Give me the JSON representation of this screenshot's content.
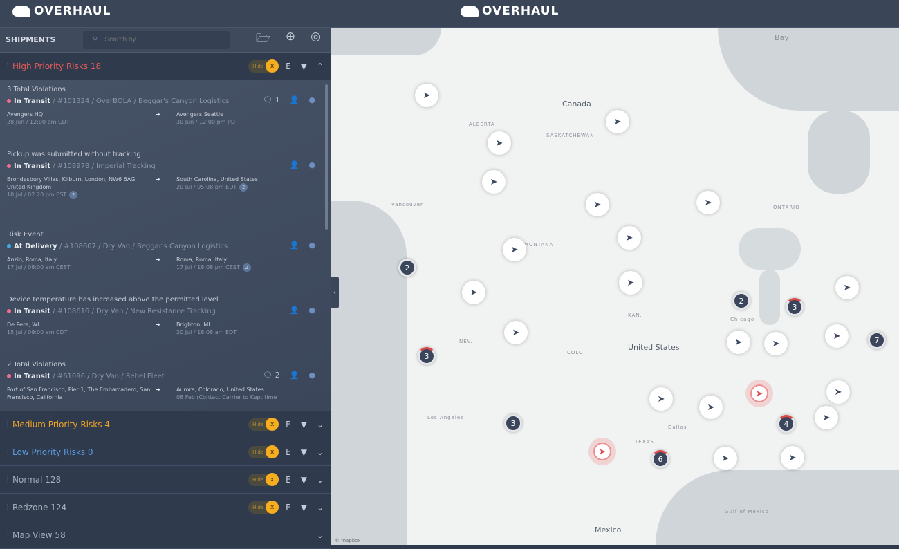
{
  "app": {
    "brand": "OVERHAUL"
  },
  "sidebar": {
    "title": "SHIPMENTS",
    "search_placeholder": "Search by",
    "groups": [
      {
        "name": "High Priority Risks 18",
        "color": "#e35a5a",
        "pill": "Hide",
        "badge": "x",
        "count": "E",
        "expanded": true
      },
      {
        "name": "Medium Priority Risks 4",
        "color": "#f0a526",
        "pill": "Hide",
        "badge": "x",
        "count": "E"
      },
      {
        "name": "Low Priority Risks 0",
        "color": "#5a9be0",
        "pill": "Hide",
        "badge": "x",
        "count": "E"
      },
      {
        "name": "Normal 128",
        "color": "#a5adba",
        "pill": "Hide",
        "badge": "x",
        "count": "E"
      },
      {
        "name": "Redzone 124",
        "color": "#a5adba",
        "pill": "Hide",
        "badge": "x",
        "count": "E"
      },
      {
        "name": "Map View 58",
        "color": "#a5adba"
      }
    ],
    "cards": [
      {
        "violation": "3 Total Violations",
        "status": "In Transit",
        "status_color": "#ef6d8f",
        "rest": " / #101324 / OverBOLA / Beggar's Canyon Logistics",
        "comments": "1",
        "from": "Avengers HQ",
        "from_time": "28 Jun / 12:00 pm CDT",
        "to": "Avengers Seattle",
        "to_time": "30 Jun / 12:00 pm PDT"
      },
      {
        "violation": "Pickup was submitted without tracking",
        "status": "In Transit",
        "status_color": "#ef6d8f",
        "rest": " / #108978 / Imperial Tracking",
        "from": "Brondesbury Villas, Kilburn, London, NW6 6AG, United Kingdom",
        "from_time": "10 Jul / 02:20 pm EST",
        "from_badge": "2",
        "to": "South Carolina, United States",
        "to_time": "20 Jul / 05:08 pm EDT",
        "to_badge": "2"
      },
      {
        "violation": "Risk Event",
        "status": "At Delivery",
        "status_color": "#3fa8e8",
        "rest": " / #108607 / Dry Van / Beggar's Canyon Logistics",
        "from": "Anzio, Roma, Italy",
        "from_time": "17 Jul / 08:00 am CEST",
        "to": "Roma, Roma, Italy",
        "to_time": "17 Jul / 18:08 pm CEST",
        "to_badge": "2"
      },
      {
        "violation": "Device temperature has increased above the permitted level",
        "status": "In Transit",
        "status_color": "#ef6d8f",
        "rest": " / #108616 / Dry Van / New Resistance Tracking",
        "from": "De Pere, WI",
        "from_time": "15 Jul / 09:00 am CDT",
        "to": "Brighton, MI",
        "to_time": "20 Jul / 18:08 am EDT"
      },
      {
        "violation": "2 Total Violations",
        "status": "In Transit",
        "status_color": "#ef6d8f",
        "rest": " / #61096 / Dry Van / Rebel Fleet",
        "comments": "2",
        "from": "Port of San Francisco, Pier 1, The Embarcadero, San Francisco, California",
        "from_time": "",
        "to": "Aurora, Colorado, United States",
        "to_time": "08 Feb (Contact Carrier to Kept time"
      }
    ]
  },
  "map": {
    "labels": {
      "canada": "Canada",
      "us": "United States",
      "mexico": "Mexico",
      "bay": "Bay",
      "chicago": "Chicago",
      "dallas": "Dallas",
      "texas": "TEXAS",
      "los_angeles": "Los Angeles",
      "vancouver": "Vancouver",
      "alberta": "ALBERTA",
      "ontario": "ONTARIO",
      "saskatchewan": "SASKATCHEWAN",
      "montana": "MONTANA",
      "nevada": "NEV.",
      "colorado": "COLO.",
      "kansas": "KAN.",
      "gulf": "Gulf of Mexico"
    },
    "clusters": [
      "2",
      "2",
      "3",
      "3",
      "7",
      "3",
      "4",
      "6"
    ],
    "attribution": "© mapbox"
  }
}
